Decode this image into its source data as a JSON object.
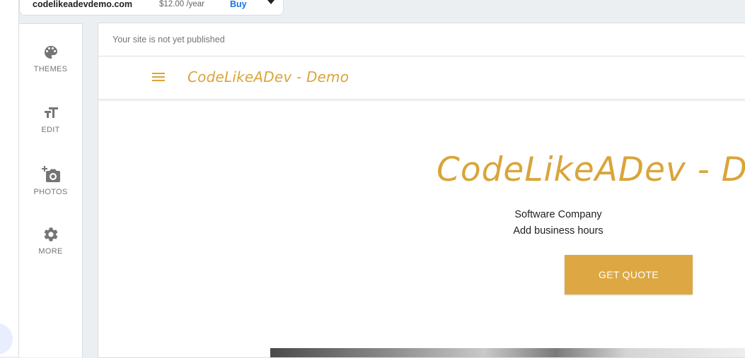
{
  "domain_bar": {
    "domain": "codelikeadevdemo.com",
    "price": "$12.00 /year",
    "buy_label": "Buy"
  },
  "rail": {
    "items": [
      {
        "label": "THEMES",
        "icon": "palette-icon"
      },
      {
        "label": "EDIT",
        "icon": "text-format-icon"
      },
      {
        "label": "PHOTOS",
        "icon": "add-photo-icon"
      },
      {
        "label": "MORE",
        "icon": "gear-icon"
      }
    ]
  },
  "preview": {
    "notice": "Your site is not yet published",
    "site_name": "CodeLikeADev - Demo",
    "hero_title": "CodeLikeADev - Demo",
    "tagline": "Software Company",
    "hours": "Add business hours",
    "cta_label": "GET QUOTE"
  },
  "colors": {
    "accent": "#d9a53a",
    "button": "#dda843",
    "link": "#1a73e8",
    "rail_icon": "#757575"
  }
}
